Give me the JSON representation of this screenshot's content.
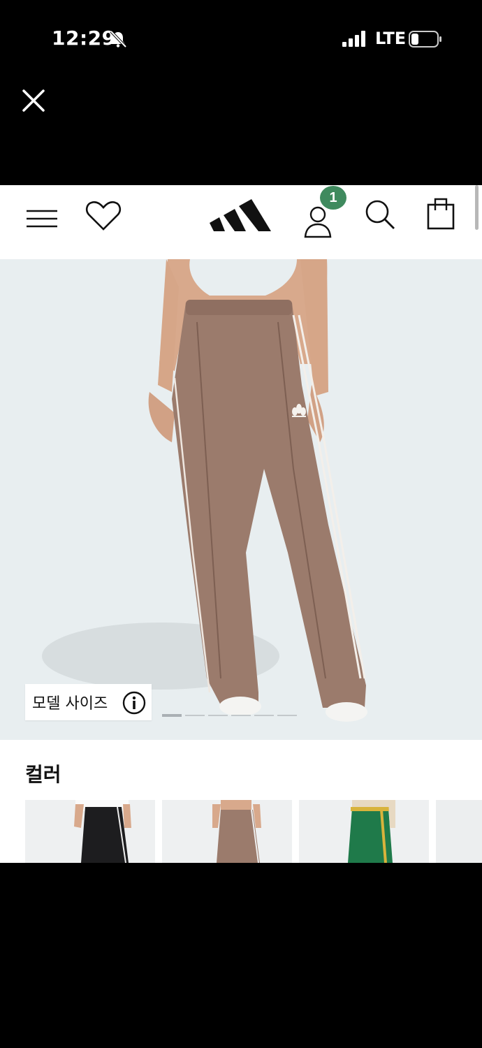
{
  "status_bar": {
    "time": "12:29",
    "network": "LTE",
    "icons": [
      "bell-slash-icon",
      "signal-bars-icon",
      "battery-icon"
    ]
  },
  "overlay": {
    "close_icon": "close-icon"
  },
  "header": {
    "icons": [
      "menu-icon",
      "heart-icon",
      "adidas-logo",
      "account-icon",
      "search-icon",
      "shopping-bag-icon"
    ],
    "account_badge_count": "1",
    "badge_color": "#3f8a5e"
  },
  "product": {
    "image_background": "#e8eef0",
    "pants_color": "#9b7b6c",
    "model_size_label": "모델 사이즈",
    "carousel_total": 6,
    "carousel_active": 1
  },
  "colors_section": {
    "heading": "컬러",
    "swatches": [
      {
        "color": "#1d1d1f",
        "name": "black"
      },
      {
        "color": "#9b7b6c",
        "name": "brown"
      },
      {
        "color": "#1f7a4a",
        "name": "green"
      },
      {
        "color": "#e9e9e9",
        "name": "partial"
      }
    ]
  }
}
